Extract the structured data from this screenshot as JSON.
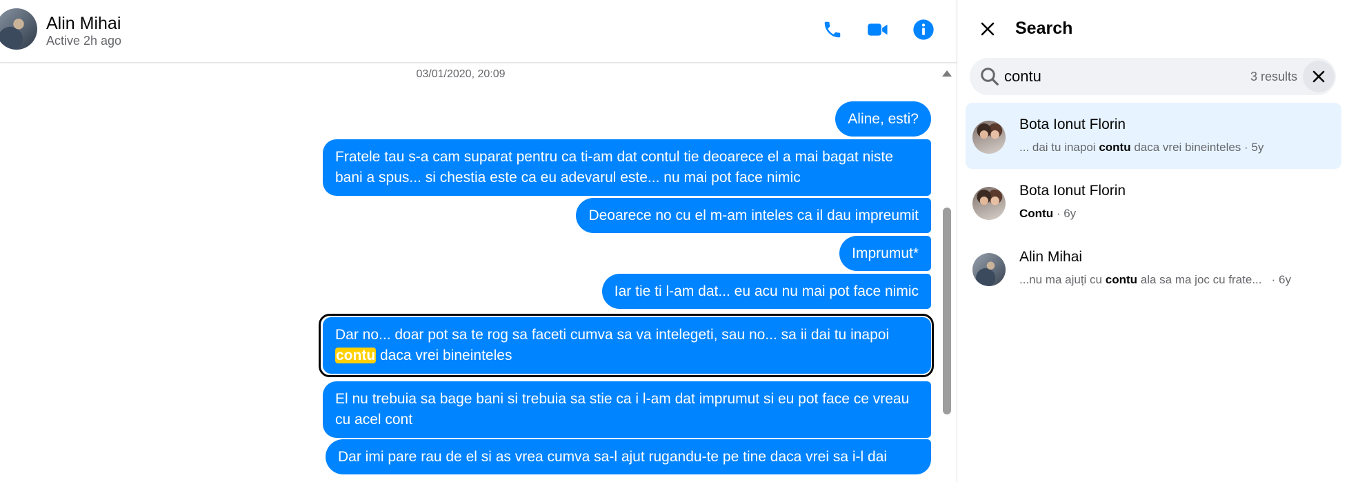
{
  "chat": {
    "contact_name": "Alin Mihai",
    "contact_status": "Active 2h ago",
    "timestamp": "03/01/2020, 20:09",
    "messages": [
      {
        "text": "Aline, esti?"
      },
      {
        "text": "Fratele tau s-a cam suparat pentru ca ti-am dat contul tie deoarece el a mai bagat niste bani a spus... si chestia este ca eu adevarul este... nu mai pot face nimic"
      },
      {
        "text": "Deoarece no cu el m-am inteles ca il dau impreumit"
      },
      {
        "text": "Imprumut*"
      },
      {
        "text": "Iar tie ti l-am dat... eu acu nu mai pot face nimic"
      },
      {
        "text_before": "Dar no... doar pot sa te rog sa faceti cumva sa va intelegeti,  sau no... sa ii dai tu inapoi ",
        "highlight": "contu",
        "text_after": " daca vrei bineinteles"
      },
      {
        "text": "El nu trebuia sa bage bani si trebuia sa stie ca i l-am dat imprumut si eu pot face ce vreau cu acel cont"
      },
      {
        "text": "Dar imi pare rau de el si as vrea cumva sa-l ajut rugandu-te pe tine daca vrei sa i-l dai"
      }
    ],
    "icons": {
      "call": "phone-icon",
      "video": "video-camera-icon",
      "info": "info-icon"
    },
    "accent_color": "#0084ff",
    "highlight_color": "#ffd000"
  },
  "search": {
    "title": "Search",
    "query": "contu",
    "result_count": "3 results",
    "results": [
      {
        "name": "Bota Ionut Florin",
        "before": "... dai tu inapoi ",
        "match": "contu",
        "after": " daca vrei bineinteles",
        "age": " · 5y"
      },
      {
        "name": "Bota Ionut Florin",
        "before": "",
        "match": "Contu",
        "after": "",
        "age": " · 6y"
      },
      {
        "name": "Alin Mihai",
        "before": "...nu ma ajuți cu ",
        "match": "contu",
        "after": " ala sa ma joc cu frate...",
        "age": "   · 6y"
      }
    ]
  }
}
